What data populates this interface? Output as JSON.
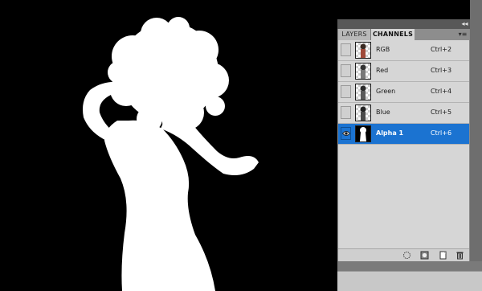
{
  "panel": {
    "tabs": [
      {
        "label": "LAYERS",
        "active": false
      },
      {
        "label": "CHANNELS",
        "active": true
      }
    ],
    "collapse_icon": "double-chevron-left-icon",
    "menu_icon": "panel-menu-icon"
  },
  "channels": [
    {
      "name": "RGB",
      "shortcut": "Ctrl+2",
      "visible": false,
      "selected": false
    },
    {
      "name": "Red",
      "shortcut": "Ctrl+3",
      "visible": false,
      "selected": false
    },
    {
      "name": "Green",
      "shortcut": "Ctrl+4",
      "visible": false,
      "selected": false
    },
    {
      "name": "Blue",
      "shortcut": "Ctrl+5",
      "visible": false,
      "selected": false
    },
    {
      "name": "Alpha 1",
      "shortcut": "Ctrl+6",
      "visible": true,
      "selected": true
    }
  ],
  "footer_icons": [
    "load-selection-icon",
    "save-selection-icon",
    "new-channel-icon",
    "delete-channel-icon"
  ],
  "colors": {
    "selection": "#1b73d1",
    "panel_bg": "#d6d6d6",
    "canvas_bg": "#000000",
    "mask_fill": "#ffffff"
  }
}
